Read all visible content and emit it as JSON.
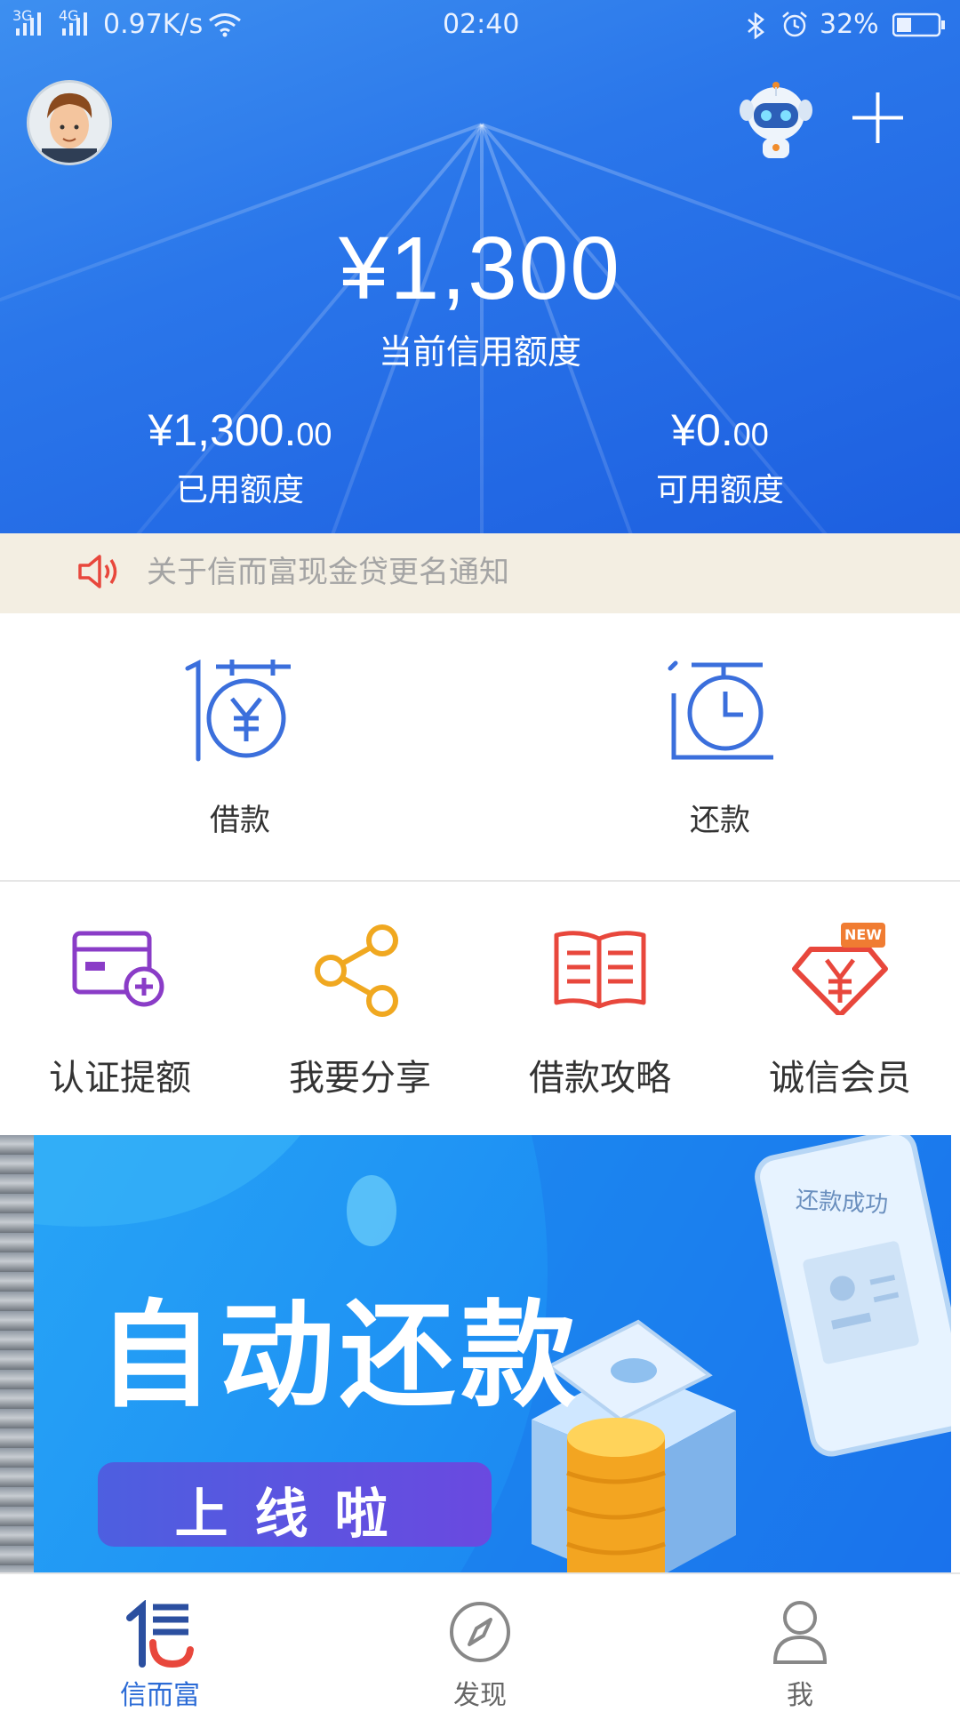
{
  "status_bar": {
    "signal_1": "3G",
    "signal_2": "4G",
    "speed": "0.97K/s",
    "time": "02:40",
    "battery": "32%"
  },
  "header": {
    "credit_amount": "¥1,300",
    "credit_label": "当前信用额度",
    "used": {
      "amount": "¥1,300.",
      "cents": "00",
      "label": "已用额度"
    },
    "available": {
      "amount": "¥0.",
      "cents": "00",
      "label": "可用额度"
    }
  },
  "notice": {
    "text": "关于信而富现金贷更名通知"
  },
  "main_actions": [
    {
      "label": "借款",
      "icon": "borrow-icon"
    },
    {
      "label": "还款",
      "icon": "repay-icon"
    }
  ],
  "grid": [
    {
      "label": "认证提额",
      "icon": "card-add-icon",
      "color": "#8a3cc7"
    },
    {
      "label": "我要分享",
      "icon": "share-icon",
      "color": "#f0a820"
    },
    {
      "label": "借款攻略",
      "icon": "book-icon",
      "color": "#e8473c"
    },
    {
      "label": "诚信会员",
      "icon": "member-icon",
      "color": "#e8473c",
      "badge": "NEW"
    }
  ],
  "banner": {
    "title": "自动还款",
    "subtitle": "上线啦",
    "phone_text": "还款成功"
  },
  "tabbar": [
    {
      "label": "信而富",
      "icon": "xin-logo-icon",
      "active": true
    },
    {
      "label": "发现",
      "icon": "compass-icon",
      "active": false
    },
    {
      "label": "我",
      "icon": "person-icon",
      "active": false
    }
  ],
  "colors": {
    "primary": "#2a76ea",
    "accent_blue": "#3b6fdc",
    "tab_active": "#2b6bd6",
    "tab_inactive": "#888888"
  }
}
